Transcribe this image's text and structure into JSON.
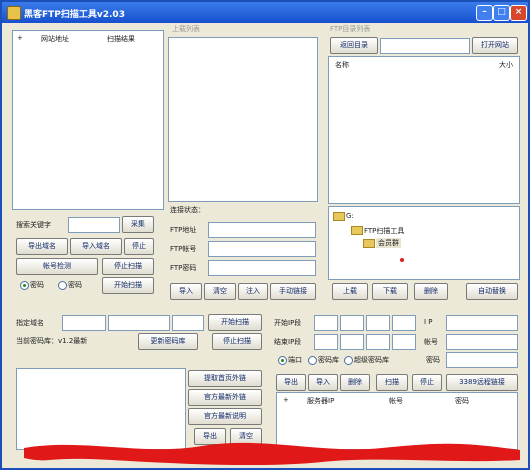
{
  "title": "黑客FTP扫描工具v2.03",
  "left_list": {
    "col_check": "+",
    "col_site": "网站地址",
    "col_result": "扫描结果"
  },
  "keyword": {
    "label": "搜索关键字",
    "search_btn": "采集"
  },
  "left_buttons": [
    "导出域名",
    "导入域名",
    "停止",
    "帐号检测",
    "停止扫描",
    "开始扫描"
  ],
  "radio": {
    "password": "密码",
    "pw2": "密码"
  },
  "upload_list": {
    "caption": "上载列表"
  },
  "ftp": {
    "status_label": "连接状态：",
    "addr_label": "FTP地址",
    "account_label": "FTP帐号",
    "password_label": "FTP密码"
  },
  "mid_buttons": [
    "导入",
    "清空",
    "注入",
    "手动链接"
  ],
  "dir": {
    "caption": "FTP目录列表",
    "return_btn": "返回目录",
    "open_btn": "打开网站",
    "col_name": "名称",
    "col_size": "大小"
  },
  "tree": {
    "root": "G:",
    "folder1": "FTP扫描工具",
    "folder2": "会员群"
  },
  "right_buttons": [
    "上载",
    "下载",
    "删除",
    "自动替换"
  ],
  "domain": {
    "label": "指定域名",
    "dict_label": "当前密码库：v1.2最新",
    "start_btn": "开始扫描",
    "update_btn": "更新密码库",
    "stop_btn": "停止扫描"
  },
  "ip": {
    "start_label": "开始IP段",
    "end_label": "结束IP段",
    "ip_label": "I P",
    "account_label": "帐号",
    "port_label": "端口",
    "dict_label": "密码库",
    "superdict_label": "超级密码库",
    "password_label": "密码"
  },
  "ip_buttons": [
    "导出",
    "导入",
    "删除",
    "扫描",
    "停止",
    "3389远程链接"
  ],
  "bottom_buttons": [
    "提取首页外链",
    "官方最新外链",
    "官方最新说明",
    "导出",
    "清空"
  ],
  "server_list": {
    "col_server": "服务器IP",
    "col_account": "帐号",
    "col_password": "密码"
  }
}
